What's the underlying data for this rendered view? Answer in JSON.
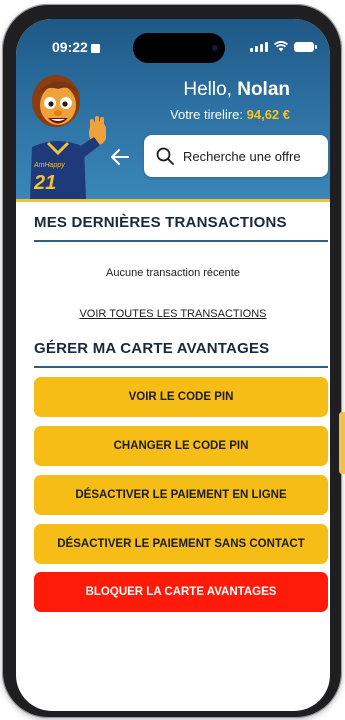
{
  "status_bar": {
    "time": "09:22"
  },
  "header": {
    "greeting_prefix": "Hello,",
    "user_name": "Nolan",
    "piggy_label": "Votre tirelire:",
    "piggy_amount": "94,62 €",
    "search_placeholder": "Recherche une offre",
    "mascot_shirt_brand": "AmHappy",
    "mascot_shirt_number": "21"
  },
  "transactions": {
    "title": "MES DERNIÈRES TRANSACTIONS",
    "empty_message": "Aucune transaction récente",
    "view_all_link": "VOIR TOUTES LES TRANSACTIONS"
  },
  "card_management": {
    "title": "GÉRER MA CARTE AVANTAGES",
    "buttons": [
      {
        "label": "VOIR LE CODE PIN"
      },
      {
        "label": "CHANGER LE CODE PIN"
      },
      {
        "label": "DÉSACTIVER LE PAIEMENT EN LIGNE"
      },
      {
        "label": "DÉSACTIVER LE PAIEMENT SANS CONTACT"
      },
      {
        "label": "BLOQUER LA CARTE AVANTAGES"
      }
    ]
  },
  "colors": {
    "header_blue": "#2c6fa0",
    "accent_yellow": "#f6bd16",
    "danger_red": "#ff1a0a",
    "title_rule": "#2d5f86"
  }
}
